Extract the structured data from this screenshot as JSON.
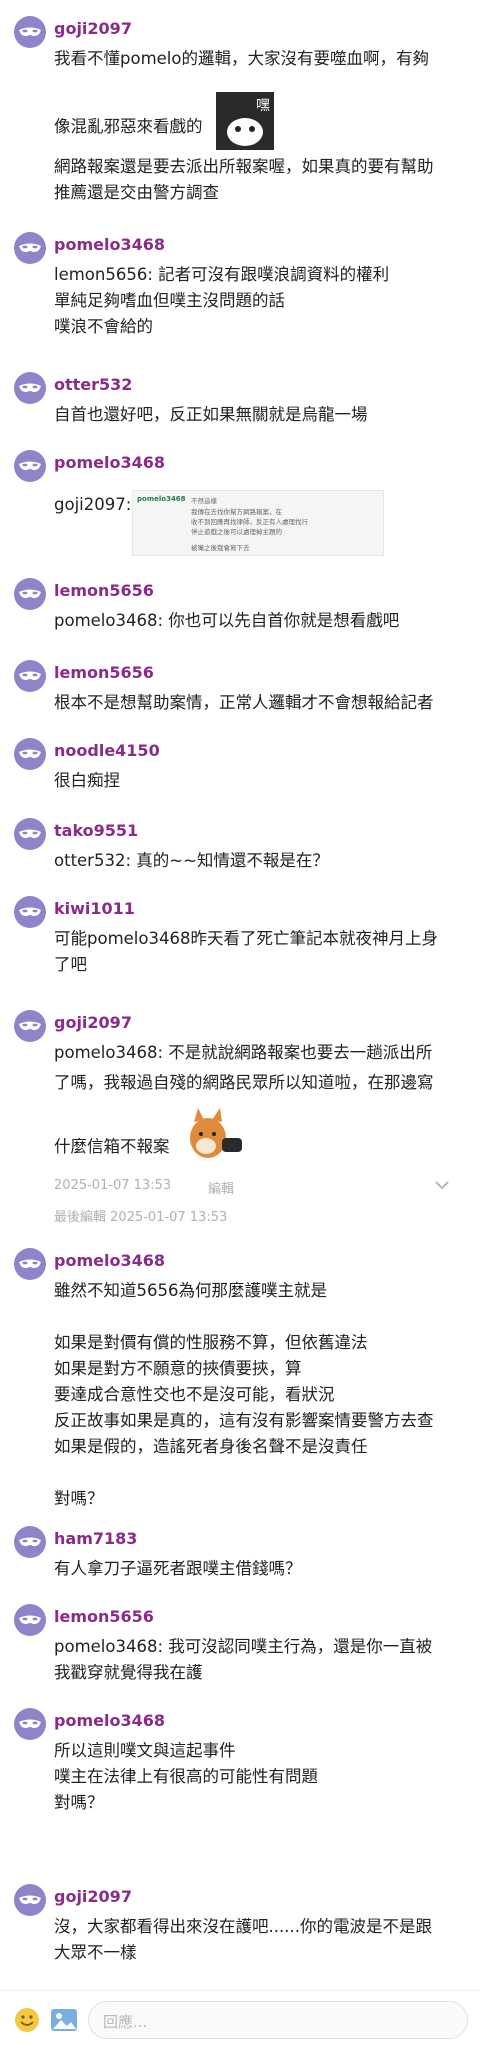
{
  "comments": [
    {
      "user": "goji2097",
      "lines": [
        "我看不懂pomelo的邏輯，大家沒有要噬血啊，有夠",
        "像混亂邪惡來看戲的",
        "網路報案還是要去派出所報案喔，如果真的要有幫助",
        "推薦還是交由警方調查"
      ]
    },
    {
      "user": "pomelo3468",
      "lines": [
        "lemon5656: 記者可沒有跟噗浪調資料的權利",
        "單純足夠嗜血但噗主沒問題的話",
        "噗浪不會給的"
      ]
    },
    {
      "user": "otter532",
      "lines": [
        "自首也還好吧，反正如果無關就是烏龍一場"
      ]
    },
    {
      "user": "pomelo3468",
      "lines": [
        "goji2097:"
      ],
      "quote": {
        "user": "pomelo3468",
        "lines": [
          "不然這樣",
          "我傳在去找你幫方網路報案，在",
          "收不到回應再找律師，反正有人處理找行",
          "停止遊戲之後可以處理掉主題的",
          "被嘴之後我會寫下去"
        ]
      }
    },
    {
      "user": "lemon5656",
      "lines": [
        "pomelo3468: 你也可以先自首你就是想看戲吧"
      ]
    },
    {
      "user": "lemon5656",
      "lines": [
        "根本不是想幫助案情，正常人邏輯才不會想報給記者"
      ]
    },
    {
      "user": "noodle4150",
      "lines": [
        "很白痴捏"
      ]
    },
    {
      "user": "tako9551",
      "lines": [
        "otter532: 真的~~知情還不報是在？"
      ]
    },
    {
      "user": "kiwi1011",
      "lines": [
        "可能pomelo3468昨天看了死亡筆記本就夜神月上身",
        "了吧"
      ]
    },
    {
      "user": "goji2097",
      "lines": [
        "pomelo3468: 不是就說網路報案也要去一趟派出所",
        "了嗎，我報過自殘的網路民眾所以知道啦，在那邊寫",
        "什麼信箱不報案"
      ],
      "timestamp": "2025-01-07 13:53",
      "edit_label": "編輯",
      "edited": "最後編輯 2025-01-07 13:53"
    },
    {
      "user": "pomelo3468",
      "lines": [
        "雖然不知道5656為何那麼護噗主就是",
        "",
        "如果是對價有償的性服務不算，但依舊違法",
        "如果是對方不願意的挾債要挾，算",
        "要達成合意性交也不是沒可能，看狀況",
        "反正故事如果是真的，這有沒有影響案情要警方去查",
        "如果是假的，造謠死者身後名聲不是沒責任",
        "",
        "對嗎？"
      ]
    },
    {
      "user": "ham7183",
      "lines": [
        "有人拿刀子逼死者跟噗主借錢嗎？"
      ]
    },
    {
      "user": "lemon5656",
      "lines": [
        "pomelo3468: 我可沒認同噗主行為，還是你一直被",
        "我戳穿就覺得我在護"
      ]
    },
    {
      "user": "pomelo3468",
      "lines": [
        "所以這則噗文與這起事件",
        "噗主在法律上有很高的可能性有問題",
        "對嗎？"
      ]
    },
    {
      "user": "goji2097",
      "lines": [
        "沒，大家都看得出來沒在護吧......你的電波是不是跟",
        "大眾不一樣"
      ]
    }
  ],
  "reply_placeholder": "回應...",
  "icons": {
    "emoji": "smiley-icon",
    "image": "image-icon",
    "avatar": "mask-icon"
  },
  "colors": {
    "username": "#8a2b8a",
    "avatar_bg": "#8f84c9",
    "meta": "#b0b0b0"
  }
}
